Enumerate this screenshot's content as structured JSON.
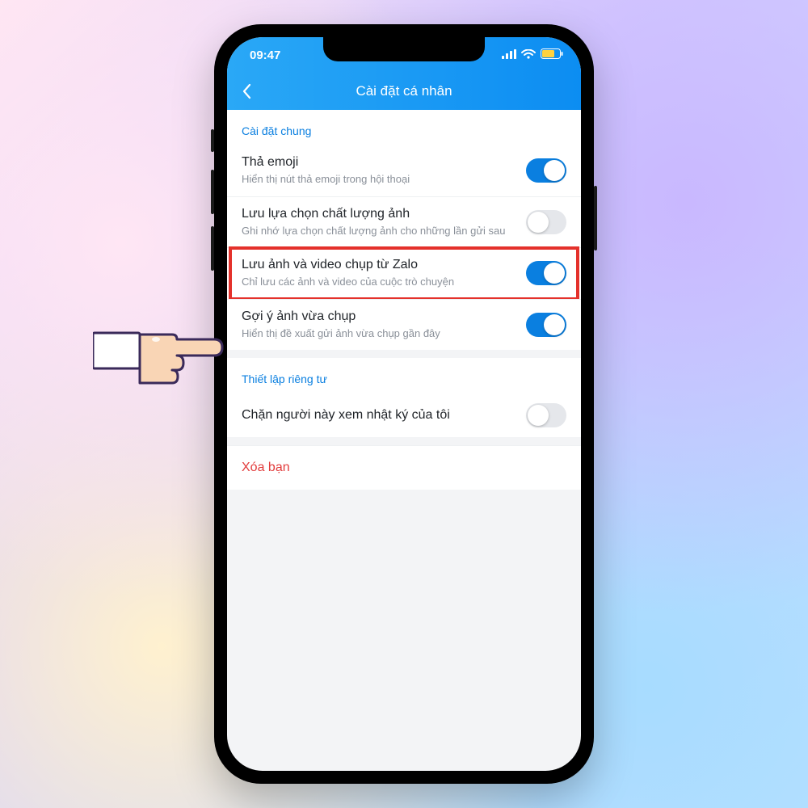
{
  "status": {
    "time": "09:47"
  },
  "nav": {
    "title": "Cài đặt cá nhân"
  },
  "sections": {
    "general": {
      "header": "Cài đặt chung",
      "items": [
        {
          "title": "Thả emoji",
          "sub": "Hiển thị nút thả emoji trong hội thoại",
          "on": true
        },
        {
          "title": "Lưu lựa chọn chất lượng ảnh",
          "sub": "Ghi nhớ lựa chọn chất lượng ảnh cho những lần gửi sau",
          "on": false
        },
        {
          "title": "Lưu ảnh và video chụp từ Zalo",
          "sub": "Chỉ lưu các ảnh và video của cuộc trò chuyện",
          "on": true,
          "highlight": true
        },
        {
          "title": "Gợi ý ảnh vừa chụp",
          "sub": "Hiển thị đề xuất gửi ảnh vừa chụp gần đây",
          "on": true
        }
      ]
    },
    "privacy": {
      "header": "Thiết lập riêng tư",
      "items": [
        {
          "title": "Chặn người này xem nhật ký của tôi",
          "on": false
        }
      ]
    }
  },
  "danger": {
    "label": "Xóa bạn"
  }
}
